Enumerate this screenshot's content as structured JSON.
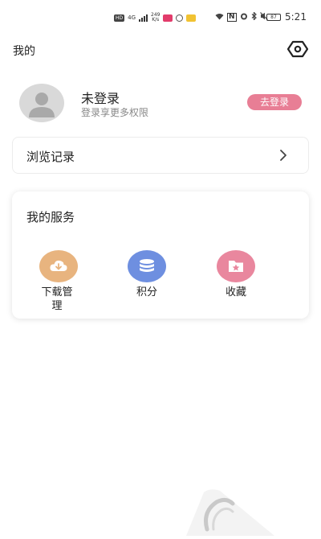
{
  "status_bar": {
    "hd": "HD",
    "network": "4G",
    "speed_value": "249",
    "speed_unit": "K/s",
    "nfc": "N",
    "battery": "87",
    "time": "5:21"
  },
  "header": {
    "title": "我的",
    "settings_icon": "settings-hexagon-icon"
  },
  "profile": {
    "name": "未登录",
    "subtitle": "登录享更多权限",
    "login_label": "去登录",
    "avatar_icon": "user-avatar-icon"
  },
  "history": {
    "label": "浏览记录",
    "chevron_icon": "chevron-right-icon"
  },
  "services": {
    "title": "我的服务",
    "items": [
      {
        "label": "下载管理",
        "icon": "download-icon",
        "color": "#e8b47f"
      },
      {
        "label": "积分",
        "icon": "coins-icon",
        "color": "#6e8fe0"
      },
      {
        "label": "收藏",
        "icon": "star-folder-icon",
        "color": "#e9879e"
      }
    ]
  },
  "colors": {
    "accent": "#e87e95",
    "download": "#e8b47f",
    "points": "#6e8fe0",
    "favorite": "#e9879e"
  }
}
